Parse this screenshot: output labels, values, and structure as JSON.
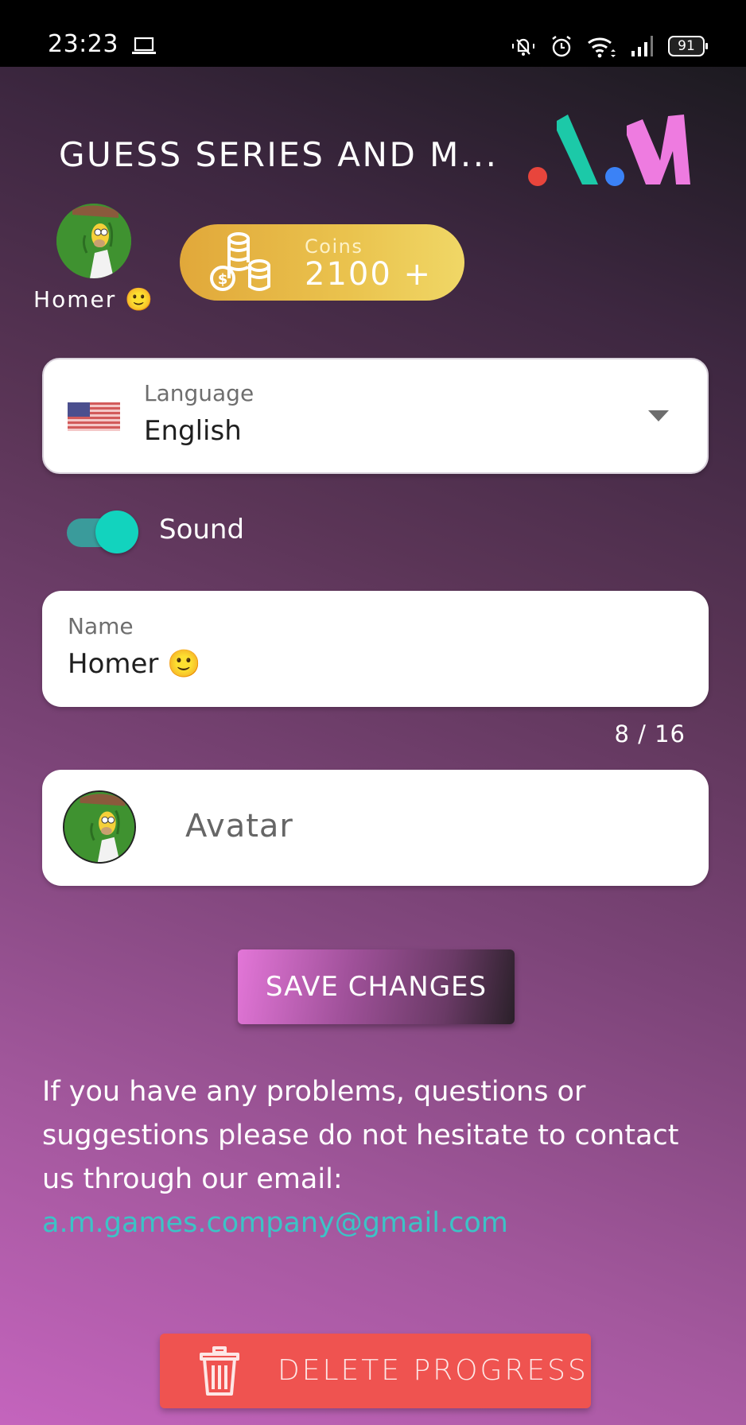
{
  "status_bar": {
    "time": "23:23",
    "battery": "91",
    "icons": [
      "laptop-icon",
      "bell-muted-icon",
      "alarm-icon",
      "wifi-icon",
      "signal-icon",
      "battery-icon"
    ]
  },
  "header": {
    "title": "GUESS SERIES AND M...",
    "logo_text": ".A.M",
    "logo_colors": {
      "dot1": "#e8453c",
      "a": "#1cc9a8",
      "dot2": "#3b82f6",
      "m": "#ee7be0"
    }
  },
  "profile": {
    "name": "Homer 🙂"
  },
  "coins": {
    "label": "Coins",
    "value": "2100 +"
  },
  "settings": {
    "language": {
      "label": "Language",
      "value": "English",
      "flag": "us-flag"
    },
    "sound": {
      "label": "Sound",
      "enabled": true
    },
    "name_field": {
      "label": "Name",
      "value": "Homer 🙂",
      "counter": "8 / 16"
    },
    "avatar_field": {
      "label": "Avatar"
    }
  },
  "actions": {
    "save_label": "SAVE CHANGES",
    "delete_label": "DELETE PROGRESS"
  },
  "help": {
    "text": "If you have any problems, questions or suggestions please do not hesitate to contact us through our email:",
    "email": "a.m.games.company@gmail.com"
  },
  "colors": {
    "accent_teal": "#12d3be",
    "delete_red": "#ef5350",
    "coin_gold": "#e8b845",
    "email_link": "#3cc3c6"
  }
}
